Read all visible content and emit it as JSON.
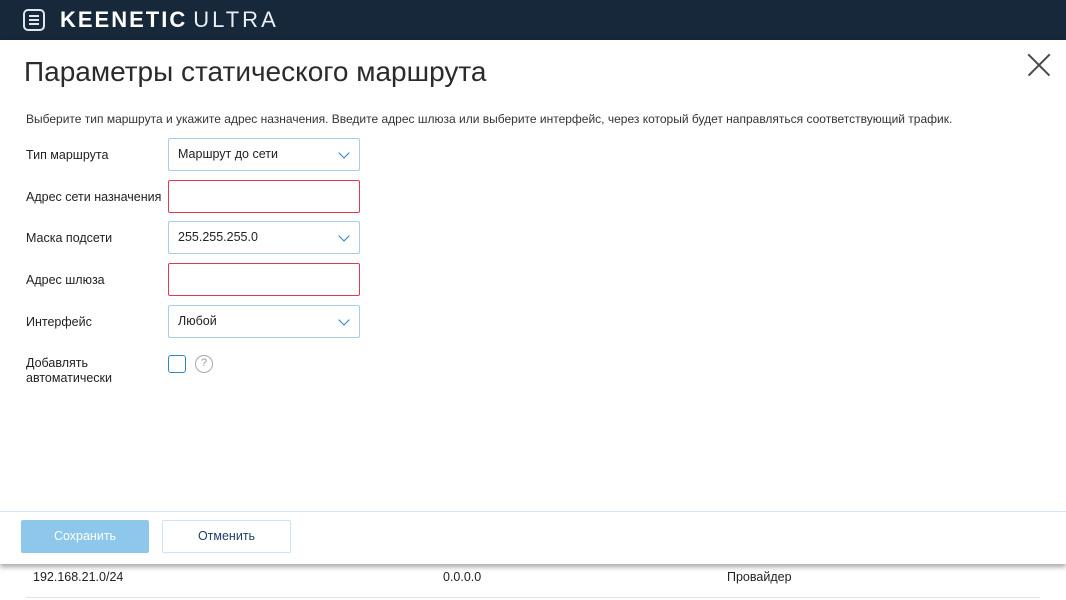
{
  "header": {
    "brand_main": "KEENETIC",
    "brand_model": "ULTRA",
    "menu_icon": "hamburger-menu-icon"
  },
  "dialog": {
    "title": "Параметры статического маршрута",
    "description": "Выберите тип маршрута и укажите адрес назначения. Введите адрес шлюза или выберите интерфейс, через который будет направляться соответствующий трафик.",
    "close_icon": "close-icon",
    "fields": {
      "route_type": {
        "label": "Тип маршрута",
        "value": "Маршрут до сети"
      },
      "destination": {
        "label": "Адрес сети назначения",
        "value": ""
      },
      "mask": {
        "label": "Маска подсети",
        "value": "255.255.255.0"
      },
      "gateway": {
        "label": "Адрес шлюза",
        "value": ""
      },
      "interface": {
        "label": "Интерфейс",
        "value": "Любой"
      },
      "auto_add": {
        "label": "Добавлять автоматически",
        "checked": false,
        "help_glyph": "?"
      }
    },
    "buttons": {
      "save": "Сохранить",
      "cancel": "Отменить"
    },
    "colors": {
      "accent": "#1d7fc6",
      "error_border": "#e0384e",
      "save_disabled": "#8ec7ec",
      "topbar": "#17283a"
    }
  },
  "background_table": {
    "row": {
      "network": "192.168.21.0/24",
      "gateway": "0.0.0.0",
      "interface": "Провайдер"
    }
  }
}
